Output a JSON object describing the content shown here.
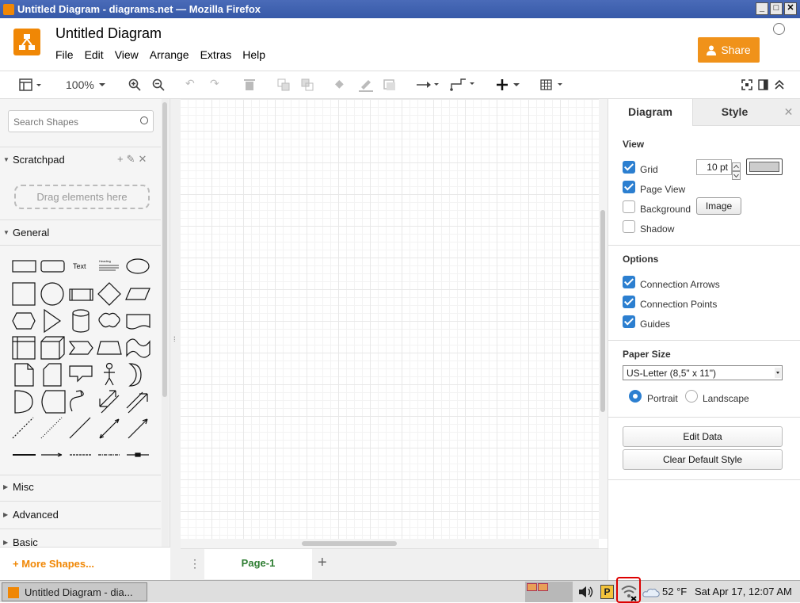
{
  "window": {
    "title": "Untitled Diagram - diagrams.net — Mozilla Firefox",
    "min": "_",
    "max": "□",
    "close": "✕"
  },
  "header": {
    "doc_title": "Untitled Diagram",
    "menu": [
      "File",
      "Edit",
      "View",
      "Arrange",
      "Extras",
      "Help"
    ],
    "share_label": "Share"
  },
  "toolbar": {
    "zoom": "100%"
  },
  "sidebar": {
    "search_placeholder": "Search Shapes",
    "scratchpad": "Scratchpad",
    "drag_hint": "Drag elements here",
    "general": "General",
    "text_shape": "Text",
    "heading_shape": "Heading",
    "misc": "Misc",
    "advanced": "Advanced",
    "basic": "Basic",
    "more_shapes": "+ More Shapes..."
  },
  "pages": {
    "tab": "Page-1",
    "add": "+",
    "menu": "⋮"
  },
  "format_panel": {
    "tab_diagram": "Diagram",
    "tab_style": "Style",
    "close": "✕",
    "view_title": "View",
    "grid": "Grid",
    "grid_size": "10 pt",
    "page_view": "Page View",
    "background": "Background",
    "image_button": "Image",
    "shadow": "Shadow",
    "options_title": "Options",
    "connection_arrows": "Connection Arrows",
    "connection_points": "Connection Points",
    "guides": "Guides",
    "paper_title": "Paper Size",
    "paper_value": "US-Letter (8,5\" x 11\")",
    "portrait": "Portrait",
    "landscape": "Landscape",
    "edit_data": "Edit Data",
    "clear_style": "Clear Default Style",
    "checked": {
      "grid": true,
      "page_view": true,
      "background": false,
      "shadow": false,
      "connection_arrows": true,
      "connection_points": true,
      "guides": true
    },
    "orientation": "portrait"
  },
  "taskbar": {
    "task_label": "Untitled Diagram - dia...",
    "weather": "52 °F",
    "clock": "Sat Apr 17, 12:07 AM"
  }
}
